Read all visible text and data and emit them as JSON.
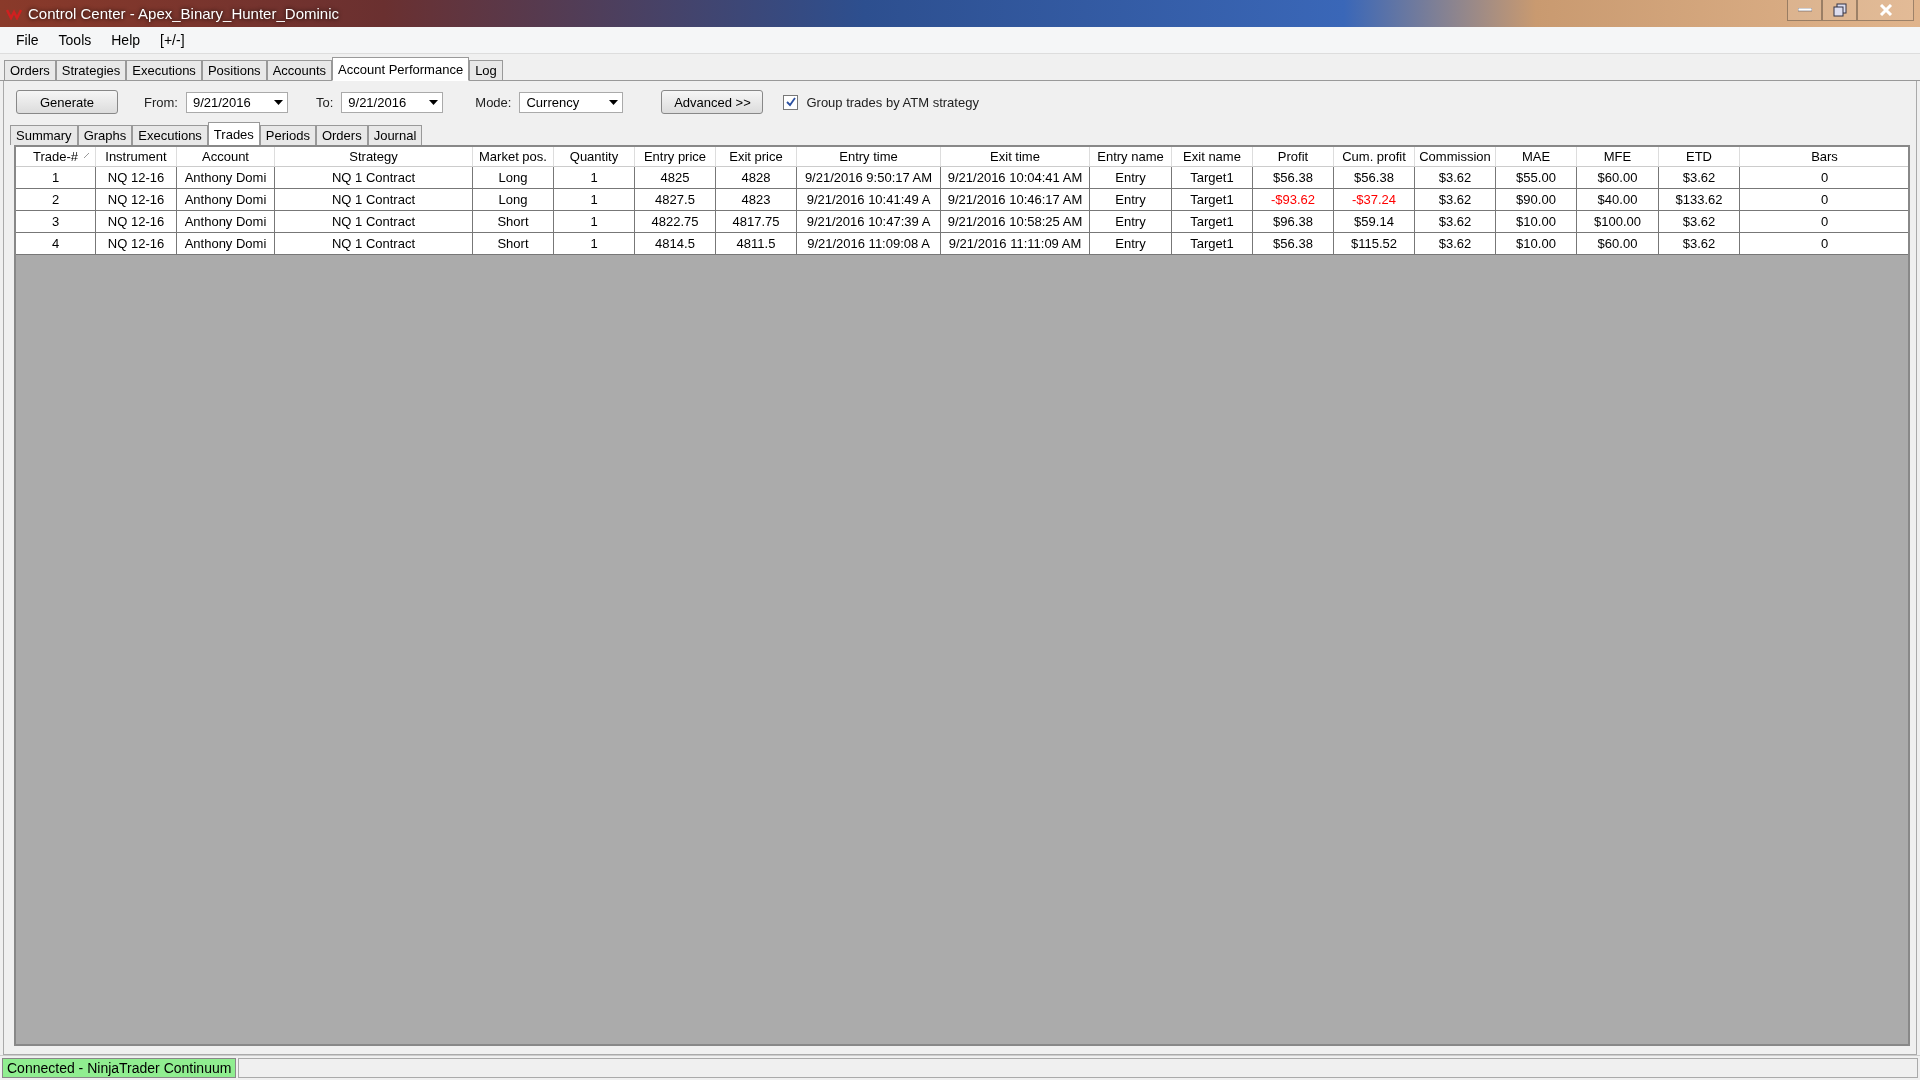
{
  "window": {
    "title": "Control Center - Apex_Binary_Hunter_Dominic"
  },
  "menu": [
    "File",
    "Tools",
    "Help",
    "[+/-]"
  ],
  "tabs": [
    {
      "label": "Orders",
      "selected": false
    },
    {
      "label": "Strategies",
      "selected": false
    },
    {
      "label": "Executions",
      "selected": false
    },
    {
      "label": "Positions",
      "selected": false
    },
    {
      "label": "Accounts",
      "selected": false
    },
    {
      "label": "Account Performance",
      "selected": true
    },
    {
      "label": "Log",
      "selected": false
    }
  ],
  "toolbar": {
    "generate": "Generate",
    "from_label": "From:",
    "from_value": "9/21/2016",
    "to_label": "To:",
    "to_value": "9/21/2016",
    "mode_label": "Mode:",
    "mode_value": "Currency",
    "advanced": "Advanced >>",
    "group_checkbox": {
      "label": "Group trades by ATM strategy",
      "checked": true
    }
  },
  "subtabs": [
    {
      "label": "Summary",
      "selected": false
    },
    {
      "label": "Graphs",
      "selected": false
    },
    {
      "label": "Executions",
      "selected": false
    },
    {
      "label": "Trades",
      "selected": true
    },
    {
      "label": "Periods",
      "selected": false
    },
    {
      "label": "Orders",
      "selected": false
    },
    {
      "label": "Journal",
      "selected": false
    }
  ],
  "table": {
    "columns": [
      "Trade-#",
      "Instrument",
      "Account",
      "Strategy",
      "Market pos.",
      "Quantity",
      "Entry price",
      "Exit price",
      "Entry time",
      "Exit time",
      "Entry name",
      "Exit name",
      "Profit",
      "Cum. profit",
      "Commission",
      "MAE",
      "MFE",
      "ETD",
      "Bars"
    ],
    "rows": [
      {
        "cells": [
          "1",
          "NQ 12-16",
          "Anthony Domi",
          "NQ 1 Contract",
          "Long",
          "1",
          "4825",
          "4828",
          "9/21/2016 9:50:17 AM",
          "9/21/2016 10:04:41 AM",
          "Entry",
          "Target1",
          "$56.38",
          "$56.38",
          "$3.62",
          "$55.00",
          "$60.00",
          "$3.62",
          "0"
        ],
        "profit_loss": false,
        "cum_profit_loss": false
      },
      {
        "cells": [
          "2",
          "NQ 12-16",
          "Anthony Domi",
          "NQ 1 Contract",
          "Long",
          "1",
          "4827.5",
          "4823",
          "9/21/2016 10:41:49 A",
          "9/21/2016 10:46:17 AM",
          "Entry",
          "Target1",
          "-$93.62",
          "-$37.24",
          "$3.62",
          "$90.00",
          "$40.00",
          "$133.62",
          "0"
        ],
        "profit_loss": true,
        "cum_profit_loss": true
      },
      {
        "cells": [
          "3",
          "NQ 12-16",
          "Anthony Domi",
          "NQ 1 Contract",
          "Short",
          "1",
          "4822.75",
          "4817.75",
          "9/21/2016 10:47:39 A",
          "9/21/2016 10:58:25 AM",
          "Entry",
          "Target1",
          "$96.38",
          "$59.14",
          "$3.62",
          "$10.00",
          "$100.00",
          "$3.62",
          "0"
        ],
        "profit_loss": false,
        "cum_profit_loss": false
      },
      {
        "cells": [
          "4",
          "NQ 12-16",
          "Anthony Domi",
          "NQ 1 Contract",
          "Short",
          "1",
          "4814.5",
          "4811.5",
          "9/21/2016 11:09:08 A",
          "9/21/2016 11:11:09 AM",
          "Entry",
          "Target1",
          "$56.38",
          "$115.52",
          "$3.62",
          "$10.00",
          "$60.00",
          "$3.62",
          "0"
        ],
        "profit_loss": false,
        "cum_profit_loss": false
      }
    ]
  },
  "status_bar": {
    "connection": "Connected - NinjaTrader Continuum"
  }
}
